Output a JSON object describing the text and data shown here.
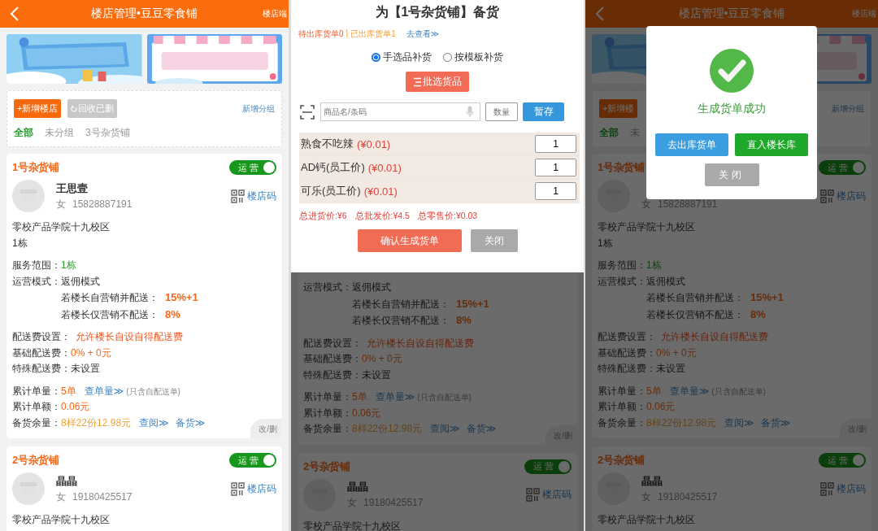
{
  "screens": [
    {
      "kind": "page",
      "page": {
        "header": {
          "title": "楼店管理•豆豆零食铺",
          "right": "楼店端"
        },
        "toolbar": {
          "add_button": "+新增楼店",
          "recycle_button": "回收已删",
          "add_group": "新增分组"
        },
        "groups": [
          {
            "label": "全部",
            "selected": true
          },
          {
            "label": "未分组",
            "selected": false
          },
          {
            "label": "3号杂货铺",
            "selected": false
          }
        ],
        "stores": [
          {
            "name": "1号杂货铺",
            "status": "运营",
            "on": true,
            "contact": {
              "name": "王思壹",
              "gender": "女",
              "phone": "15828887191"
            },
            "qr_label": "楼店码",
            "sections": [
              [
                {
                  "kind": "text",
                  "text": "零校产品学院十九校区"
                },
                {
                  "kind": "text",
                  "text": "1栋"
                }
              ],
              [
                {
                  "kind": "field",
                  "label": "服务范围：",
                  "value": "1栋",
                  "color": "#2a9d2a"
                },
                {
                  "kind": "field",
                  "label": "运营模式：",
                  "value": "返佣模式",
                  "color": "#333333"
                },
                {
                  "kind": "sub",
                  "label": "若楼长自营销并配送：",
                  "value": "15%+1",
                  "color": "#f26a1b"
                },
                {
                  "kind": "sub",
                  "label": "若楼长仅营销不配送：",
                  "value": "8%",
                  "color": "#f26a1b"
                }
              ],
              [
                {
                  "kind": "field_small",
                  "label": "配送费设置：",
                  "value": "允许楼长自设自得配送费",
                  "color": "#f2561d"
                },
                {
                  "kind": "field",
                  "label": "基础配送费：",
                  "value": "0% + 0元",
                  "color": "#f26a1b"
                },
                {
                  "kind": "field",
                  "label": "特殊配送费：",
                  "value": "未设置",
                  "color": "#333333"
                }
              ],
              [
                {
                  "kind": "field",
                  "label": "累计单量：",
                  "value": "5单",
                  "color": "#f26a1b",
                  "links": [
                    "查单量≫"
                  ],
                  "note": "(只含自配送单)"
                },
                {
                  "kind": "field",
                  "label": "累计单额：",
                  "value": "0.06元",
                  "color": "#f26a1b"
                },
                {
                  "kind": "field",
                  "label": "备货余量：",
                  "value": "8样22份12.98元",
                  "color": "#f0a238",
                  "links": [
                    "查阅≫",
                    "备货≫"
                  ]
                }
              ]
            ],
            "corner": "改/删"
          },
          {
            "name": "2号杂货铺",
            "status": "运营",
            "on": true,
            "contact": {
              "name": "晶晶",
              "gender": "女",
              "phone": "19180425517"
            },
            "qr_label": "楼店码",
            "sections": [
              [
                {
                  "kind": "text",
                  "text": "零校产品学院十九校区"
                }
              ]
            ]
          }
        ]
      }
    },
    {
      "kind": "sheet",
      "sheet": {
        "title": "为【1号杂货铺】备货",
        "pending": "待出库货单0",
        "separator": "|",
        "shipped": "已出库货单1",
        "view_link": "去查看≫",
        "modes": [
          {
            "label": "手选品补货",
            "selected": true
          },
          {
            "label": "按模板补货",
            "selected": false
          }
        ],
        "batch_button": "批选货品",
        "search_placeholder": "商品名/条码",
        "qty_placeholder": "数量",
        "save_button": "暂存",
        "items": [
          {
            "name": "熟食不吃辣",
            "price": "(¥0.01)",
            "qty": "1"
          },
          {
            "name": "AD钙(员工价)",
            "price": "(¥0.01)",
            "qty": "1"
          },
          {
            "name": "可乐(员工价)",
            "price": "(¥0.01)",
            "qty": "1"
          }
        ],
        "totals": [
          "总进货价:¥6",
          "总批发价:¥4.5",
          "总零售价:¥0.03"
        ],
        "confirm_button": "确认生成货单",
        "close_button": "关闭"
      },
      "page": {
        "stores": [
          {
            "sections": [
              [
                {
                  "kind": "field",
                  "label": "运营模式：",
                  "value": "返佣模式",
                  "color": "#151515"
                },
                {
                  "kind": "sub",
                  "label": "若楼长自营销并配送：",
                  "value": "15%+1",
                  "color": "#662d0b"
                },
                {
                  "kind": "sub",
                  "label": "若楼长仅营销不配送：",
                  "value": "8%",
                  "color": "#662d0b"
                }
              ],
              [
                {
                  "kind": "field_small",
                  "label": "配送费设置：",
                  "value": "允许楼长自设自得配送费",
                  "color": "#66240c"
                },
                {
                  "kind": "field",
                  "label": "基础配送费：",
                  "value": "0% + 0元",
                  "color": "#662d0b"
                },
                {
                  "kind": "field",
                  "label": "特殊配送费：",
                  "value": "未设置",
                  "color": "#151515"
                }
              ],
              [
                {
                  "kind": "field",
                  "label": "累计单量：",
                  "value": "5单",
                  "color": "#662d0b",
                  "links": [
                    "查单量≫"
                  ],
                  "note": "(只含自配送单)"
                },
                {
                  "kind": "field",
                  "label": "累计单额：",
                  "value": "0.06元",
                  "color": "#662d0b"
                },
                {
                  "kind": "field",
                  "label": "备货余量：",
                  "value": "8样22份12.98元",
                  "color": "#654418",
                  "links": [
                    "查阅≫",
                    "备货≫"
                  ]
                }
              ]
            ],
            "corner": "改/删"
          },
          {
            "name": "2号杂货铺",
            "status": "运营",
            "on": true,
            "contact": {
              "name": "晶晶",
              "gender": "女",
              "phone": "19180425517"
            },
            "qr_label": "楼店码",
            "sections": [
              [
                {
                  "kind": "text",
                  "text": "零校产品学院十九校区"
                }
              ]
            ]
          }
        ]
      }
    },
    {
      "kind": "page",
      "page": {
        "header": {
          "title": "楼店管理•豆豆零食铺",
          "right": "楼店端"
        },
        "toolbar": {
          "add_button": "+新增楼",
          "add_group": "新增分组"
        },
        "groups": [
          {
            "label": "全部",
            "selected": true
          },
          {
            "label": "未",
            "selected": false
          }
        ],
        "stores": [
          {
            "name": "1号杂货铺",
            "status": "运营",
            "on": true,
            "contact": {
              "gender": "女",
              "phone": "15828887191"
            },
            "qr_label": "楼店码",
            "sections": [
              [
                {
                  "kind": "text",
                  "text": "零校产品学院十九校区"
                },
                {
                  "kind": "text",
                  "text": "1栋"
                }
              ],
              [
                {
                  "kind": "field",
                  "label": "服务范围：",
                  "value": "1栋",
                  "color": "#124212"
                },
                {
                  "kind": "field",
                  "label": "运营模式：",
                  "value": "返佣模式",
                  "color": "#151515"
                },
                {
                  "kind": "sub",
                  "label": "若楼长自营销并配送：",
                  "value": "15%+1",
                  "color": "#662d0b"
                },
                {
                  "kind": "sub",
                  "label": "若楼长仅营销不配送：",
                  "value": "8%",
                  "color": "#662d0b"
                }
              ],
              [
                {
                  "kind": "field_small",
                  "label": "配送费设置：",
                  "value": "允许楼长自设自得配送费",
                  "color": "#66240c"
                },
                {
                  "kind": "field",
                  "label": "基础配送费：",
                  "value": "0% + 0元",
                  "color": "#662d0b"
                },
                {
                  "kind": "field",
                  "label": "特殊配送费：",
                  "value": "未设置",
                  "color": "#151515"
                }
              ],
              [
                {
                  "kind": "field",
                  "label": "累计单量：",
                  "value": "5单",
                  "color": "#662d0b",
                  "links": [
                    "查单量≫"
                  ],
                  "note": "(只含自配送单)"
                },
                {
                  "kind": "field",
                  "label": "累计单额：",
                  "value": "0.06元",
                  "color": "#662d0b"
                },
                {
                  "kind": "field",
                  "label": "备货余量：",
                  "value": "8样22份12.98元",
                  "color": "#654418",
                  "links": [
                    "查阅≫",
                    "备货≫"
                  ]
                }
              ]
            ],
            "corner": "改/删"
          },
          {
            "name": "2号杂货铺",
            "status": "运营",
            "on": true,
            "contact": {
              "name": "晶晶",
              "gender": "女",
              "phone": "19180425517"
            },
            "qr_label": "楼店码",
            "sections": [
              [
                {
                  "kind": "text",
                  "text": "零校产品学院十九校区"
                }
              ]
            ]
          }
        ]
      },
      "dialog": {
        "message": "生成货单成功",
        "buttons": [
          {
            "label": "去出库货单",
            "kind": "primary"
          },
          {
            "label": "直入楼长库",
            "kind": "success"
          },
          {
            "label": "关闭",
            "kind": "muted"
          }
        ]
      }
    }
  ]
}
